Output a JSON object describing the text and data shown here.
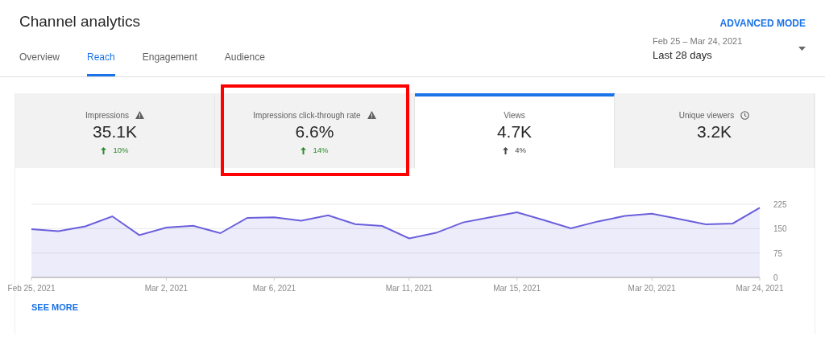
{
  "title": "Channel analytics",
  "advanced_mode": "ADVANCED MODE",
  "tabs": [
    {
      "label": "Overview",
      "selected": false
    },
    {
      "label": "Reach",
      "selected": true
    },
    {
      "label": "Engagement",
      "selected": false
    },
    {
      "label": "Audience",
      "selected": false
    }
  ],
  "date_range": {
    "range": "Feb 25 – Mar 24, 2021",
    "period": "Last 28 days"
  },
  "metrics": [
    {
      "label": "Impressions",
      "kind": "warning",
      "value": "35.1K",
      "trend": {
        "text": "10%",
        "color": "#2e8b2e"
      },
      "selected": false,
      "highlighted": false
    },
    {
      "label": "Impressions click-through rate",
      "kind": "warning",
      "value": "6.6%",
      "trend": {
        "text": "14%",
        "color": "#2e8b2e"
      },
      "selected": false,
      "highlighted": true
    },
    {
      "label": "Views",
      "kind": "plain",
      "value": "4.7K",
      "trend": {
        "text": "4%",
        "color": "#444444"
      },
      "selected": true,
      "highlighted": false
    },
    {
      "label": "Unique viewers",
      "kind": "clock",
      "value": "3.2K",
      "selected": false,
      "highlighted": false
    }
  ],
  "chart_data": {
    "type": "area",
    "categories": [
      "Feb 25, 2021",
      null,
      null,
      null,
      null,
      "Mar 2, 2021",
      null,
      null,
      null,
      "Mar 6, 2021",
      null,
      null,
      null,
      null,
      "Mar 11, 2021",
      null,
      null,
      null,
      "Mar 15, 2021",
      null,
      null,
      null,
      null,
      "Mar 20, 2021",
      null,
      null,
      null,
      "Mar 24, 2021"
    ],
    "series": [
      {
        "color": "#6a5fdc",
        "values": [
          148,
          142,
          157,
          188,
          130,
          153,
          159,
          136,
          183,
          185,
          174,
          191,
          164,
          158,
          120,
          137,
          169,
          185,
          200,
          176,
          151,
          172,
          189,
          196,
          180,
          163,
          166,
          214
        ]
      }
    ],
    "ylim": [
      0,
      225
    ],
    "yticks": [
      0,
      75,
      150,
      225
    ]
  },
  "see_more": "SEE MORE"
}
